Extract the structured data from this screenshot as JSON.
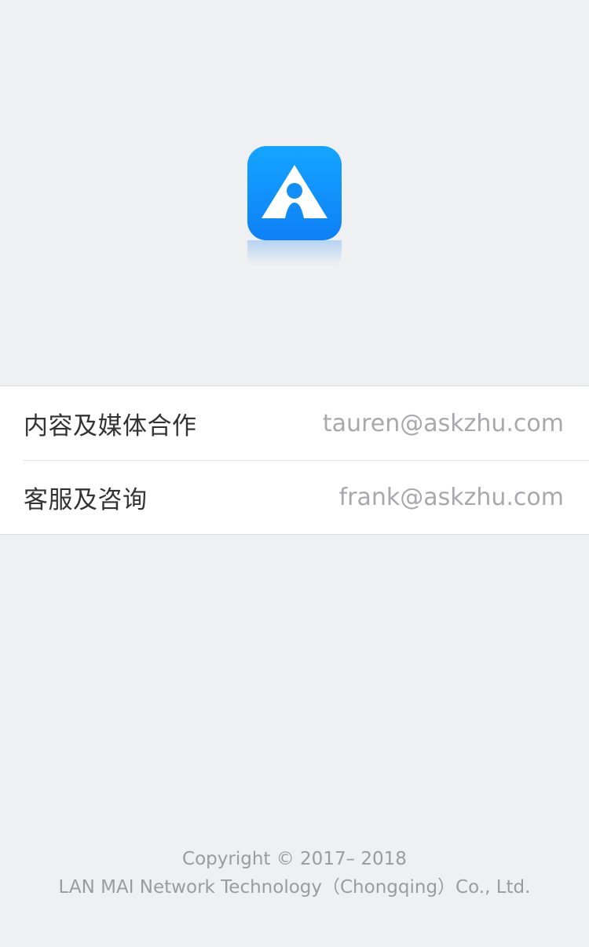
{
  "app": {
    "icon": "askzhu-logo-icon",
    "brand_color": "#0e80f7"
  },
  "contacts": [
    {
      "label": "内容及媒体合作",
      "email": "tauren@askzhu.com"
    },
    {
      "label": "客服及咨询",
      "email": "frank@askzhu.com"
    }
  ],
  "footer": {
    "copyright": "Copyright © 2017– 2018",
    "company": "LAN MAI Network Technology（Chongqing）Co., Ltd."
  }
}
